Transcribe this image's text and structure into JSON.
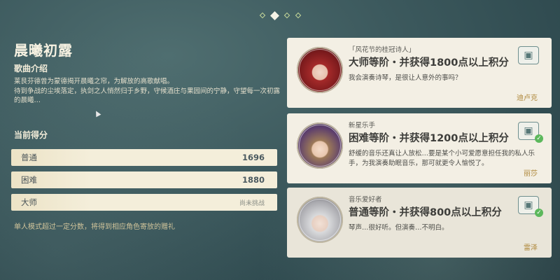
{
  "pager": {
    "count": 4,
    "active_index": 1
  },
  "song": {
    "title": "晨曦初露",
    "intro_label": "歌曲介绍",
    "description": [
      "莱艮芬德曾为蒙德揭开晨曦之帘，为解放的高歌献唱。",
      "待到争战的尘埃落定，执剑之人悄然归于乡野，守候酒庄与果园间的宁静，守望每一次初露的晨曦…"
    ]
  },
  "scores": {
    "label": "当前得分",
    "rows": [
      {
        "level": "普通",
        "value": "1696"
      },
      {
        "level": "困难",
        "value": "1880"
      },
      {
        "level": "大师",
        "value": "尚未挑战"
      }
    ],
    "hint": "单人模式超过一定分数，将得到相应角色寄放的赠礼"
  },
  "rewards": [
    {
      "tag": "「风花节的桂冠诗人」",
      "headline": "大师等阶・并获得1800点以上积分",
      "quote": "我会演奏诗琴，是很让人意外的事吗？",
      "signer": "迪卢克",
      "claimed": false,
      "icon": "gift-box-icon"
    },
    {
      "tag": "新星乐手",
      "headline": "困难等阶・并获得1200点以上积分",
      "quote": "舒缓的音乐还真让人放松…要是某个小可爱愿意担任我的私人乐手，为我演奏助眠音乐，那可就更令人愉悦了。",
      "signer": "丽莎",
      "claimed": true,
      "icon": "gift-box-icon"
    },
    {
      "tag": "音乐爱好者",
      "headline": "普通等阶・并获得800点以上积分",
      "quote": "琴声…很好听。但演奏…不明白。",
      "signer": "雷泽",
      "claimed": true,
      "icon": "gift-box-icon"
    }
  ],
  "colors": {
    "background": "#3d5a5e",
    "card": "#f3efe4",
    "score_row": "#f4eeda",
    "accent_gold": "#b08a3e",
    "check_green": "#5cb85c"
  }
}
